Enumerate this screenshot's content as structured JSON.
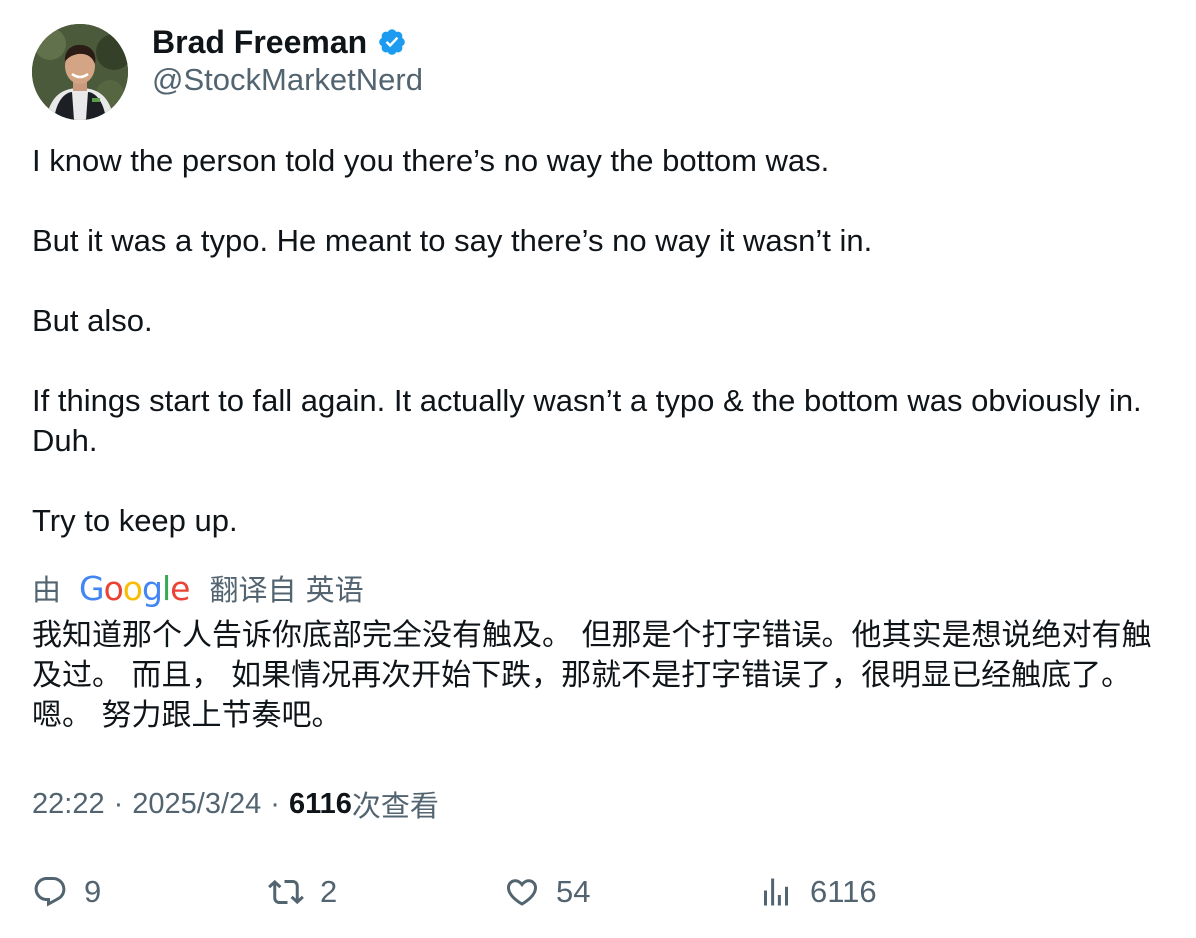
{
  "author": {
    "name": "Brad Freeman",
    "handle": "@StockMarketNerd",
    "verified": true
  },
  "tweet": {
    "paragraphs": [
      "I know the person told you there’s no way the bottom was.",
      "But it was a typo. He meant to say there’s no way it wasn’t in.",
      "But also.",
      "If things start to fall again. It actually wasn’t a typo & the bottom was obviously in. Duh.",
      "Try to keep up."
    ]
  },
  "translation": {
    "prefix": "由",
    "provider": "Google",
    "suffix": "翻译自 英语",
    "text": "我知道那个人告诉你底部完全没有触及。 但那是个打字错误。他其实是想说绝对有触及过。 而且， 如果情况再次开始下跌，那就不是打字错误了，很明显已经触底了。嗯。 努力跟上节奏吧。"
  },
  "meta": {
    "time": "22:22",
    "separator": "·",
    "date": "2025/3/24",
    "views_count": "6116",
    "views_label": "次查看"
  },
  "actions": {
    "replies": "9",
    "retweets": "2",
    "likes": "54",
    "views": "6116"
  },
  "colors": {
    "text_primary": "#0f1419",
    "text_secondary": "#536471",
    "verified_badge": "#1d9bf0"
  },
  "icons": {
    "verified": "verified-badge-icon",
    "reply": "reply-icon",
    "retweet": "retweet-icon",
    "like": "heart-icon",
    "views": "analytics-bars-icon"
  }
}
